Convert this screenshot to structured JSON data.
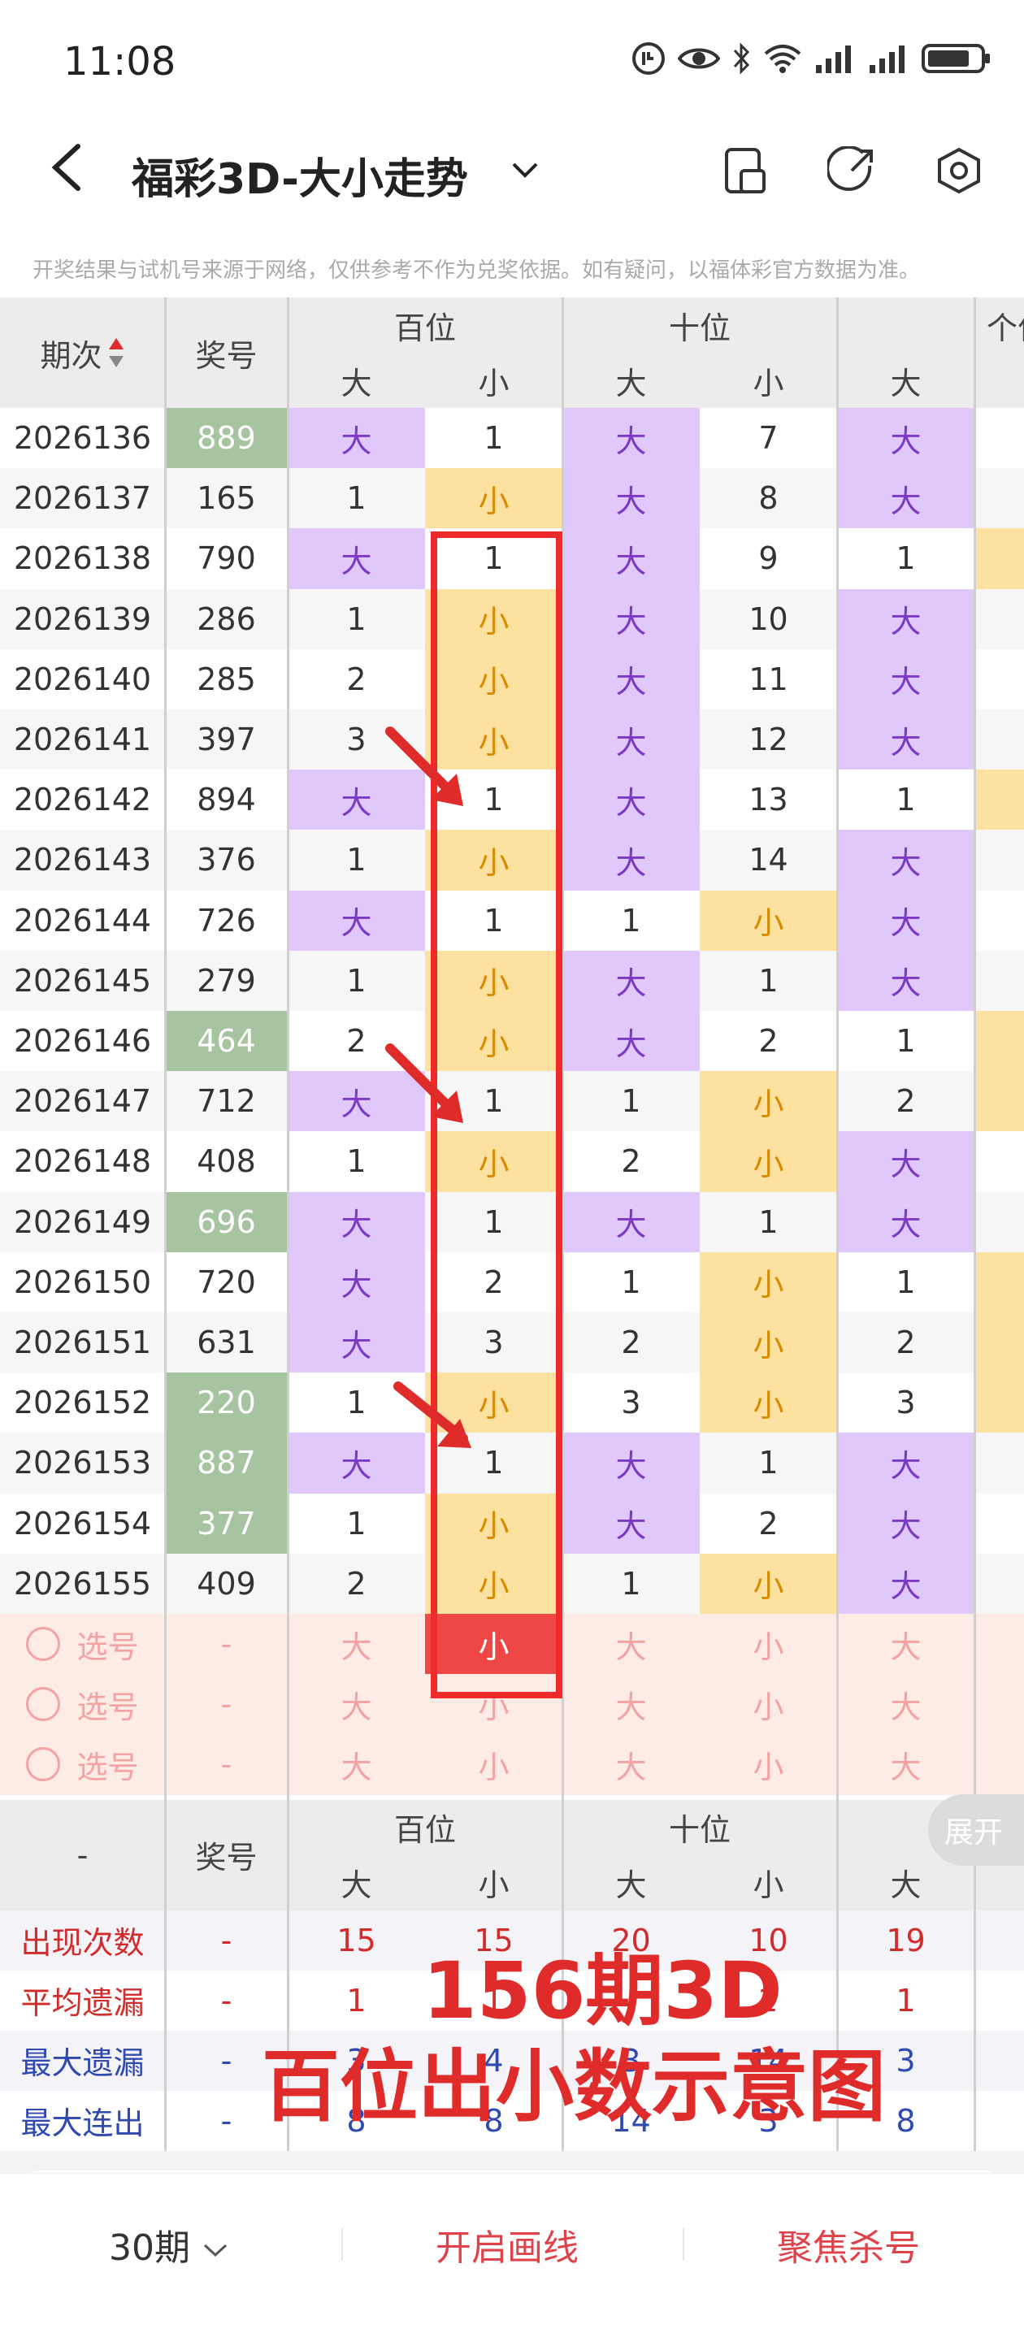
{
  "status": {
    "time": "11:08"
  },
  "header": {
    "title": "福彩3D-大小走势"
  },
  "notice": "开奖结果与试机号来源于网络，仅供参考不作为兑奖依据。如有疑问，以福体彩官方数据为准。",
  "table": {
    "col_period": "期次",
    "col_number": "奖号",
    "groups": [
      "百位",
      "十位",
      "个位"
    ],
    "sub_big": "大",
    "sub_small": "小",
    "rows": [
      {
        "period": "2026136",
        "num": "889",
        "h": [
          "大",
          "1"
        ],
        "t": [
          "大",
          "7"
        ],
        "o": "大"
      },
      {
        "period": "2026137",
        "num": "165",
        "h": [
          "1",
          "小"
        ],
        "t": [
          "大",
          "8"
        ],
        "o": "大"
      },
      {
        "period": "2026138",
        "num": "790",
        "h": [
          "大",
          "1"
        ],
        "t": [
          "大",
          "9"
        ],
        "o": "1"
      },
      {
        "period": "2026139",
        "num": "286",
        "h": [
          "1",
          "小"
        ],
        "t": [
          "大",
          "10"
        ],
        "o": "大"
      },
      {
        "period": "2026140",
        "num": "285",
        "h": [
          "2",
          "小"
        ],
        "t": [
          "大",
          "11"
        ],
        "o": "大"
      },
      {
        "period": "2026141",
        "num": "397",
        "h": [
          "3",
          "小"
        ],
        "t": [
          "大",
          "12"
        ],
        "o": "大"
      },
      {
        "period": "2026142",
        "num": "894",
        "h": [
          "大",
          "1"
        ],
        "t": [
          "大",
          "13"
        ],
        "o": "1"
      },
      {
        "period": "2026143",
        "num": "376",
        "h": [
          "1",
          "小"
        ],
        "t": [
          "大",
          "14"
        ],
        "o": "大"
      },
      {
        "period": "2026144",
        "num": "726",
        "h": [
          "大",
          "1"
        ],
        "t": [
          "1",
          "小"
        ],
        "o": "大"
      },
      {
        "period": "2026145",
        "num": "279",
        "h": [
          "1",
          "小"
        ],
        "t": [
          "大",
          "1"
        ],
        "o": "大"
      },
      {
        "period": "2026146",
        "num": "464",
        "h": [
          "2",
          "小"
        ],
        "t": [
          "大",
          "2"
        ],
        "o": "1"
      },
      {
        "period": "2026147",
        "num": "712",
        "h": [
          "大",
          "1"
        ],
        "t": [
          "1",
          "小"
        ],
        "o": "2"
      },
      {
        "period": "2026148",
        "num": "408",
        "h": [
          "1",
          "小"
        ],
        "t": [
          "2",
          "小"
        ],
        "o": "大"
      },
      {
        "period": "2026149",
        "num": "696",
        "h": [
          "大",
          "1"
        ],
        "t": [
          "大",
          "1"
        ],
        "o": "大"
      },
      {
        "period": "2026150",
        "num": "720",
        "h": [
          "大",
          "2"
        ],
        "t": [
          "1",
          "小"
        ],
        "o": "1"
      },
      {
        "period": "2026151",
        "num": "631",
        "h": [
          "大",
          "3"
        ],
        "t": [
          "2",
          "小"
        ],
        "o": "2"
      },
      {
        "period": "2026152",
        "num": "220",
        "h": [
          "1",
          "小"
        ],
        "t": [
          "3",
          "小"
        ],
        "o": "3"
      },
      {
        "period": "2026153",
        "num": "887",
        "h": [
          "大",
          "1"
        ],
        "t": [
          "大",
          "1"
        ],
        "o": "大"
      },
      {
        "period": "2026154",
        "num": "377",
        "h": [
          "1",
          "小"
        ],
        "t": [
          "大",
          "2"
        ],
        "o": "大"
      },
      {
        "period": "2026155",
        "num": "409",
        "h": [
          "2",
          "小"
        ],
        "t": [
          "1",
          "小"
        ],
        "o": "大"
      }
    ],
    "select_label": "选号",
    "select_dash": "-"
  },
  "stats": {
    "header_dash": "-",
    "header_number": "奖号",
    "rows": [
      {
        "label": "出现次数",
        "dash": "-",
        "vals": [
          "15",
          "15",
          "20",
          "10",
          "19"
        ]
      },
      {
        "label": "平均遗漏",
        "dash": "-",
        "vals": [
          "1",
          "1",
          "",
          "2",
          "1"
        ]
      },
      {
        "label": "最大遗漏",
        "dash": "-",
        "vals": [
          "3",
          "4",
          "3",
          "14",
          "3"
        ]
      },
      {
        "label": "最大连出",
        "dash": "-",
        "vals": [
          "8",
          "8",
          "14",
          "3",
          "8"
        ]
      }
    ]
  },
  "overlay": {
    "line1": "156期3D",
    "line2": "百位出小数示意图"
  },
  "expand_label": "展开",
  "bottom": {
    "periods": "30期",
    "draw": "开启画线",
    "kill": "聚焦杀号"
  },
  "colors": {
    "big_bg": "#e0c8fa",
    "small_bg": "#fde1a0",
    "highlight_num": "#a6c4a0",
    "accent_red": "#e02b2b"
  },
  "highlight_rows": [
    "2026136",
    "2026146",
    "2026149",
    "2026152",
    "2026153",
    "2026154"
  ]
}
